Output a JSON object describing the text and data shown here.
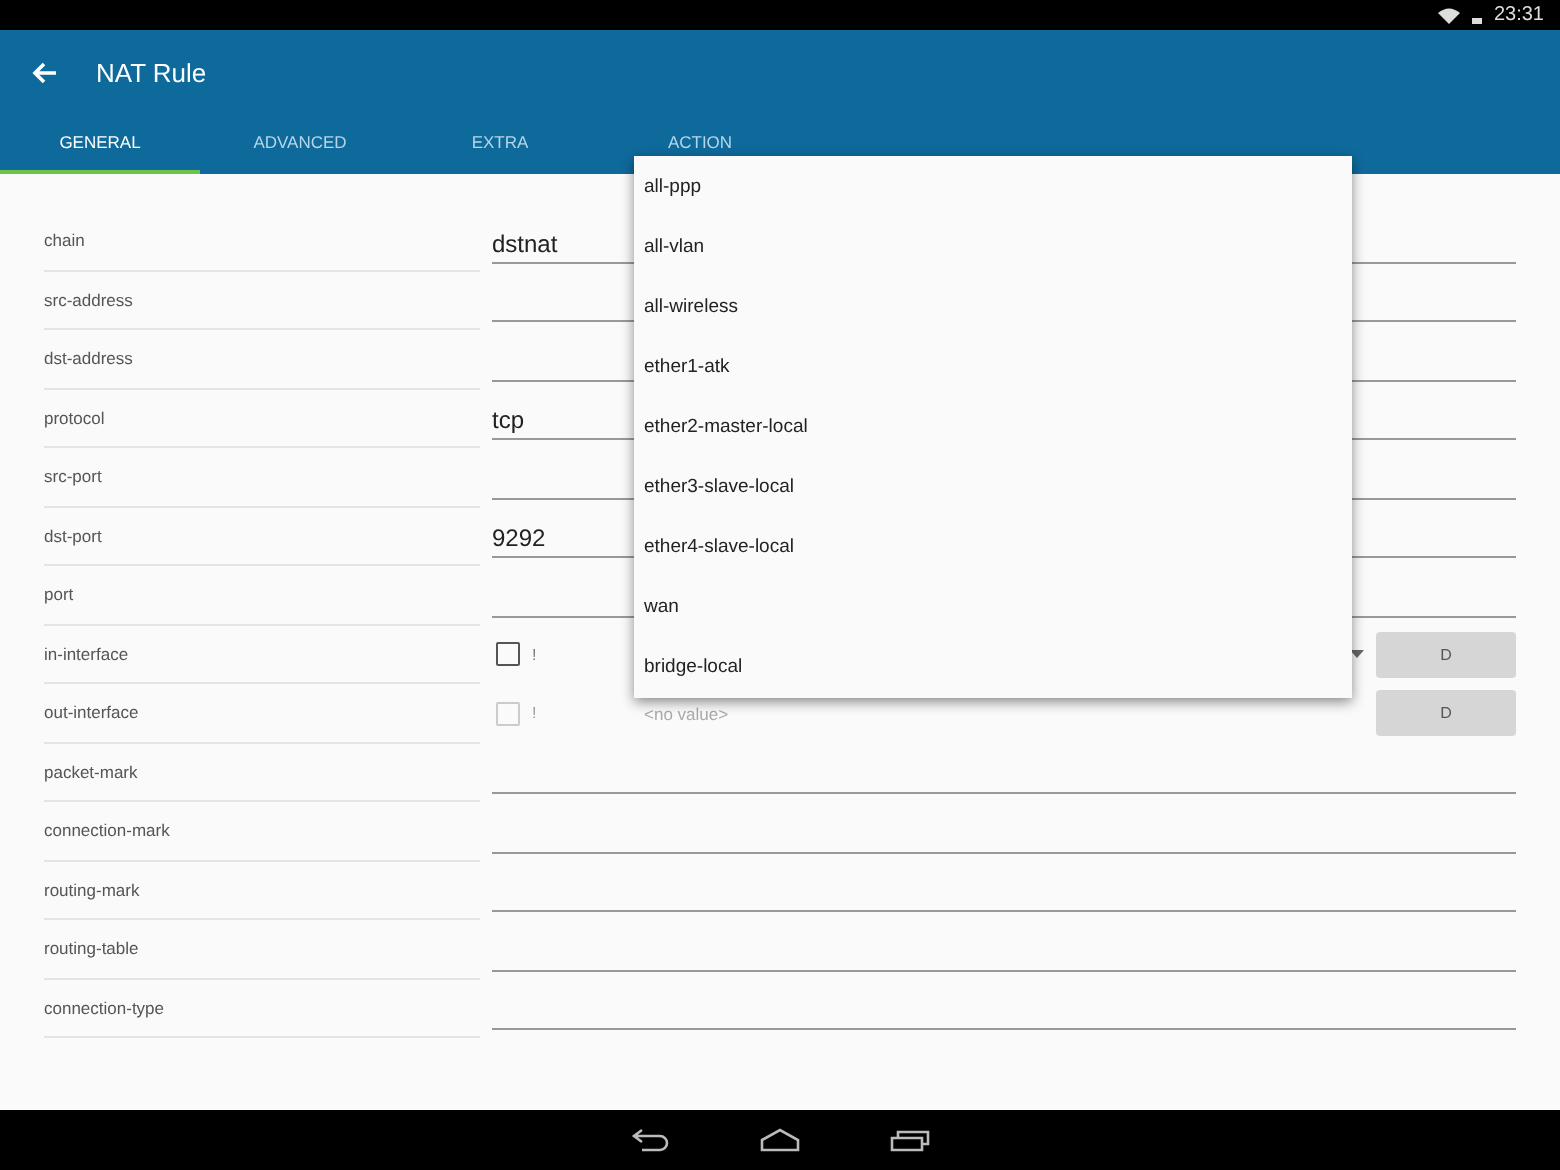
{
  "status_bar": {
    "time": "23:31"
  },
  "app_bar": {
    "title": "NAT Rule"
  },
  "tabs": [
    {
      "label": "GENERAL",
      "selected": true
    },
    {
      "label": "ADVANCED",
      "selected": false
    },
    {
      "label": "EXTRA",
      "selected": false
    },
    {
      "label": "ACTION",
      "selected": false
    }
  ],
  "fields": [
    {
      "kind": "text",
      "label": "chain",
      "value": "dstnat"
    },
    {
      "kind": "text",
      "label": "src-address"
    },
    {
      "kind": "text",
      "label": "dst-address"
    },
    {
      "kind": "text",
      "label": "protocol",
      "value": "tcp"
    },
    {
      "kind": "text",
      "label": "src-port"
    },
    {
      "kind": "text",
      "label": "dst-port",
      "value": "9292"
    },
    {
      "kind": "text",
      "label": "port"
    },
    {
      "kind": "interface",
      "label": "in-interface",
      "negate": "!",
      "checked": false,
      "disabled": false,
      "button": "D"
    },
    {
      "kind": "interface",
      "label": "out-interface",
      "negate": "!",
      "checked": false,
      "disabled": true,
      "placeholder": "<no value>",
      "button": "D"
    },
    {
      "kind": "text",
      "label": "packet-mark"
    },
    {
      "kind": "text",
      "label": "connection-mark"
    },
    {
      "kind": "text",
      "label": "routing-mark"
    },
    {
      "kind": "text",
      "label": "routing-table"
    },
    {
      "kind": "text",
      "label": "connection-type"
    }
  ],
  "dropdown": {
    "options": [
      "all-ppp",
      "all-vlan",
      "all-wireless",
      "ether1-atk",
      "ether2-master-local",
      "ether3-slave-local",
      "ether4-slave-local",
      "wan",
      "bridge-local"
    ]
  }
}
